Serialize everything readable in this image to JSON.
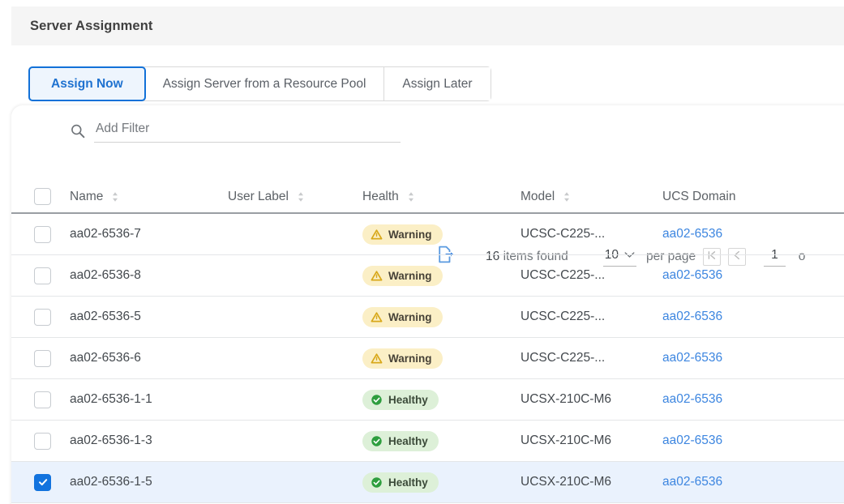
{
  "header": {
    "title": "Server Assignment"
  },
  "tabs": [
    {
      "label": "Assign Now",
      "active": true
    },
    {
      "label": "Assign Server from a Resource Pool",
      "active": false
    },
    {
      "label": "Assign Later",
      "active": false
    }
  ],
  "toolbar": {
    "filter_placeholder": "Add Filter",
    "search_icon": "search-icon",
    "export_icon": "export-icon",
    "items_found_count": "16",
    "items_found_text": "items found",
    "per_page_value": "10",
    "per_page_label": "per page",
    "first_page_icon": "first-page-icon",
    "prev_page_icon": "previous-page-icon",
    "current_page": "1",
    "of_text": "o"
  },
  "table": {
    "columns": [
      {
        "key": "name",
        "label": "Name",
        "sortable": true
      },
      {
        "key": "user",
        "label": "User Label",
        "sortable": true
      },
      {
        "key": "health",
        "label": "Health",
        "sortable": true
      },
      {
        "key": "model",
        "label": "Model",
        "sortable": true
      },
      {
        "key": "ucs",
        "label": "UCS Domain",
        "sortable": false
      }
    ],
    "rows": [
      {
        "selected": false,
        "name": "aa02-6536-7",
        "user_label": "",
        "health": "Warning",
        "health_state": "warning",
        "model": "UCSC-C225-...",
        "ucs_domain": "aa02-6536"
      },
      {
        "selected": false,
        "name": "aa02-6536-8",
        "user_label": "",
        "health": "Warning",
        "health_state": "warning",
        "model": "UCSC-C225-...",
        "ucs_domain": "aa02-6536"
      },
      {
        "selected": false,
        "name": "aa02-6536-5",
        "user_label": "",
        "health": "Warning",
        "health_state": "warning",
        "model": "UCSC-C225-...",
        "ucs_domain": "aa02-6536"
      },
      {
        "selected": false,
        "name": "aa02-6536-6",
        "user_label": "",
        "health": "Warning",
        "health_state": "warning",
        "model": "UCSC-C225-...",
        "ucs_domain": "aa02-6536"
      },
      {
        "selected": false,
        "name": "aa02-6536-1-1",
        "user_label": "",
        "health": "Healthy",
        "health_state": "healthy",
        "model": "UCSX-210C-M6",
        "ucs_domain": "aa02-6536"
      },
      {
        "selected": false,
        "name": "aa02-6536-1-3",
        "user_label": "",
        "health": "Healthy",
        "health_state": "healthy",
        "model": "UCSX-210C-M6",
        "ucs_domain": "aa02-6536"
      },
      {
        "selected": true,
        "name": "aa02-6536-1-5",
        "user_label": "",
        "health": "Healthy",
        "health_state": "healthy",
        "model": "UCSX-210C-M6",
        "ucs_domain": "aa02-6536"
      }
    ]
  },
  "colors": {
    "accent_blue": "#1271d8",
    "link_blue": "#3d86e0",
    "warning_bg": "#fbefc6",
    "warning_icon": "#e3b31e",
    "healthy_bg": "#ddf0d8",
    "healthy_icon": "#2e9e3e",
    "header_strip": "#f5f5f5",
    "selected_row": "#eaf2fd"
  }
}
